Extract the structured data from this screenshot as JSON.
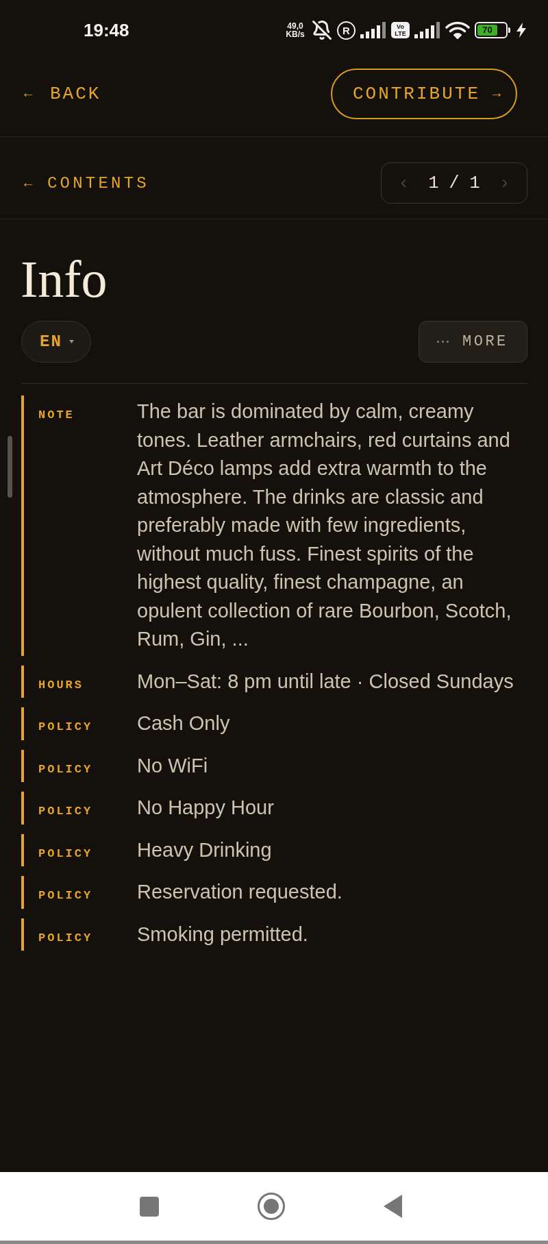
{
  "status_bar": {
    "time": "19:48",
    "net_speed": "49,0 KB/s",
    "registered": "R",
    "volte": "Vo LTE",
    "battery": "70"
  },
  "header": {
    "back": {
      "arrow": "←",
      "label": "BACK"
    },
    "contribute": {
      "label": "CONTRIBUTE",
      "arrow": "→"
    }
  },
  "subheader": {
    "contents": {
      "arrow": "←",
      "label": "CONTENTS"
    },
    "pager": {
      "prev": {
        "glyph": "‹",
        "disabled": true
      },
      "page": "1 / 1",
      "next": {
        "glyph": "›",
        "disabled": true
      }
    }
  },
  "title": "Info",
  "language": {
    "label": "EN"
  },
  "more": {
    "label": "MORE"
  },
  "entries": [
    {
      "label": "NOTE",
      "text": "The bar is dominated by calm, creamy tones. Leather armchairs, red curtains and Art Déco lamps add extra warmth to the atmosphere. The drinks are classic and preferably made with few ingredients, without much fuss. Finest spirits of the highest quality, finest champagne, an opulent collection of rare Bourbon, Scotch, Rum, Gin, ..."
    },
    {
      "label": "HOURS",
      "text": "Mon–Sat: 8 pm until late · Closed Sundays"
    },
    {
      "label": "POLICY",
      "text": "Cash Only"
    },
    {
      "label": "POLICY",
      "text": "No WiFi"
    },
    {
      "label": "POLICY",
      "text": "No Happy Hour"
    },
    {
      "label": "POLICY",
      "text": "Heavy Drinking"
    },
    {
      "label": "POLICY",
      "text": "Reservation requested."
    },
    {
      "label": "POLICY",
      "text": "Smoking permitted."
    }
  ]
}
